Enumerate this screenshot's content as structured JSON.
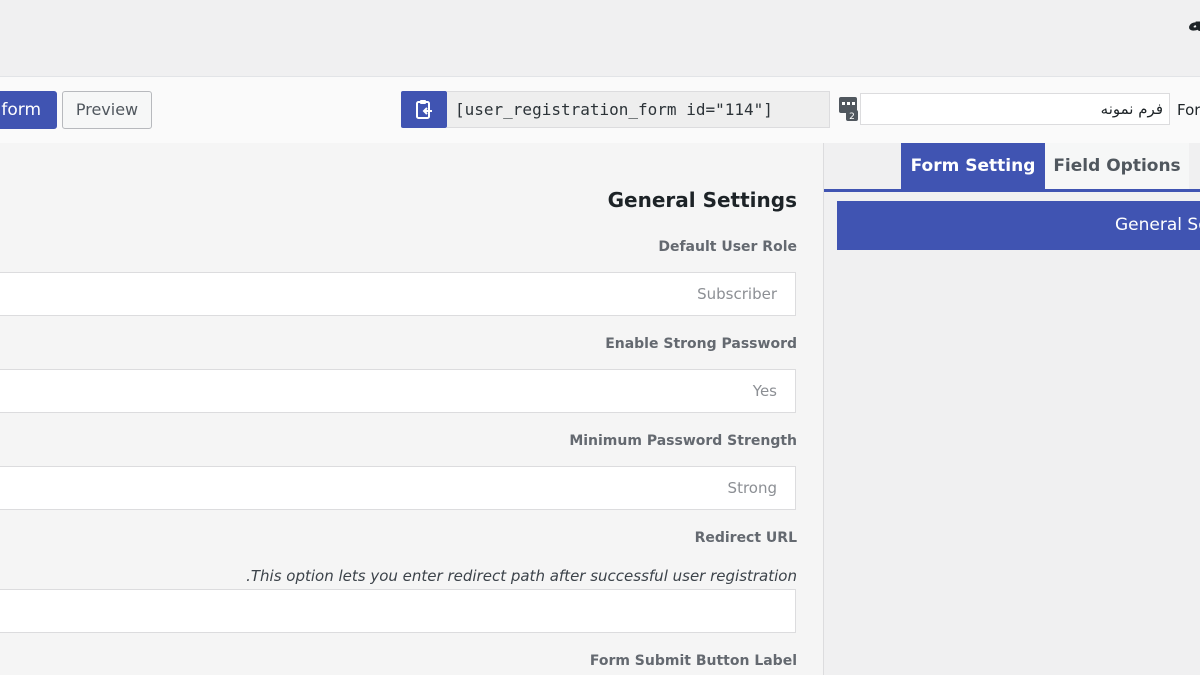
{
  "page": {
    "title": "ـه"
  },
  "toolbar": {
    "update_label": "e form",
    "preview_label": "Preview",
    "shortcode": "[user_registration_form id=\"114\"]",
    "form_title_value": "فرم نمونه",
    "form_title_label": "For"
  },
  "main": {
    "heading": "General Settings",
    "fields": [
      {
        "label": "Default User Role",
        "value": "Subscriber"
      },
      {
        "label": "Enable Strong Password",
        "value": "Yes"
      },
      {
        "label": "Minimum Password Strength",
        "value": "Strong"
      },
      {
        "label": "Redirect URL",
        "description": ".This option lets you enter redirect path after successful user registration",
        "value": ""
      },
      {
        "label": "Form Submit Button Label"
      }
    ]
  },
  "sidebar": {
    "tabs": [
      {
        "label": "Form Setting"
      },
      {
        "label": "Field Options"
      }
    ],
    "section_header": "General Se"
  },
  "colors": {
    "accent": "#4054b2",
    "background": "#f0f0f1",
    "panel": "#f5f5f5"
  },
  "icons": {
    "copy": "clipboard-copy-icon",
    "form_title": "form-id-icon"
  }
}
